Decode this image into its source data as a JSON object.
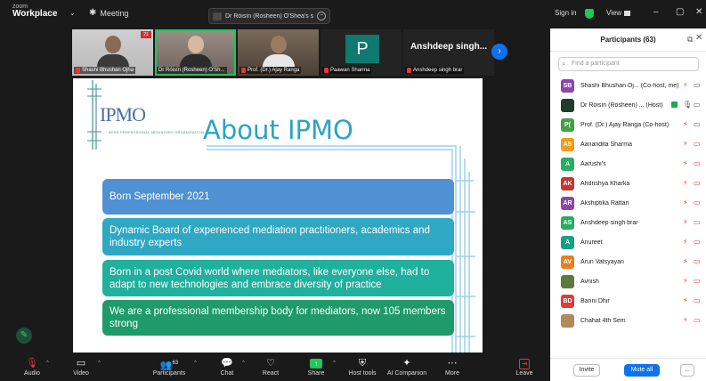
{
  "app": {
    "brand_line1": "zoom",
    "brand_line2": "Workplace",
    "meeting_label": "Meeting",
    "share_chip": "Dr Róisín (Rosheen) O'Shea's scre",
    "signin": "Sign in",
    "view": "View"
  },
  "videos": [
    {
      "name": "Shashi Bhushan Ojha",
      "badge": "21"
    },
    {
      "name": "Dr Róisín (Rosheen) O'Sh..."
    },
    {
      "name": "Prof. (Dr.) Ajay Ranga"
    },
    {
      "name": "Paawan Sharma",
      "initial": "P"
    },
    {
      "name": "Anshdeep singh brar",
      "display": "Anshdeep singh..."
    }
  ],
  "slide": {
    "logo_text": "IPMO",
    "logo_subtext": "IRISH PROFESSIONAL MEDIATORS ORGANISATION",
    "title": "About IPMO",
    "bullets": [
      "Born September 2021",
      "Dynamic Board of experienced mediation practitioners, academics and industry experts",
      "Born in a post Covid world where mediators, like everyone else, had to adapt to new technologies and embrace diversity of practice",
      "We are a professional membership body for mediators, now 105 members strong"
    ],
    "colors": {
      "title": "#2aa3c8",
      "b1": "#4f91d3",
      "b2": "#2fa8c4",
      "b3": "#1fb09e",
      "b4": "#1f9a6a"
    }
  },
  "toolbar": {
    "audio": "Audio",
    "video": "Video",
    "participants": "Participants",
    "participants_count": "63",
    "chat": "Chat",
    "react": "React",
    "share": "Share",
    "host_tools": "Host tools",
    "ai_companion": "AI Companion",
    "more": "More",
    "leave": "Leave"
  },
  "panel": {
    "title": "Participants (63)",
    "search_placeholder": "Find a participant",
    "participants": [
      {
        "initials": "SB",
        "color": "#8e44ad",
        "name": "Shashi Bhushan Oj... (Co-host, me)"
      },
      {
        "initials": "",
        "color": "#2e7d32",
        "name": "Dr Róisín (Rosheen) ... (Host)"
      },
      {
        "initials": "P(",
        "color": "#43a047",
        "name": "Prof. (Dr.) Ajay Ranga (Co-host)"
      },
      {
        "initials": "AS",
        "color": "#f39c12",
        "name": "Aanandita Sharma"
      },
      {
        "initials": "A",
        "color": "#27ae60",
        "name": "Aarushi's"
      },
      {
        "initials": "AK",
        "color": "#c0392b",
        "name": "Ahdrishya Kharka"
      },
      {
        "initials": "AR",
        "color": "#8e44ad",
        "name": "Akshiptika Rattan"
      },
      {
        "initials": "AS",
        "color": "#27ae60",
        "name": "Anshdeep singh brar"
      },
      {
        "initials": "A",
        "color": "#16a085",
        "name": "Anureet"
      },
      {
        "initials": "AV",
        "color": "#e67e22",
        "name": "Arun Vatsyayan"
      },
      {
        "initials": "",
        "color": "#5d7a3a",
        "name": "Avnish"
      },
      {
        "initials": "BD",
        "color": "#e53935",
        "name": "Banni Dhir"
      },
      {
        "initials": "",
        "color": "#b08a5a",
        "name": "Chahat 4th Sem"
      }
    ],
    "invite": "Invite",
    "mute_all": "Mute all",
    "more": "..."
  }
}
